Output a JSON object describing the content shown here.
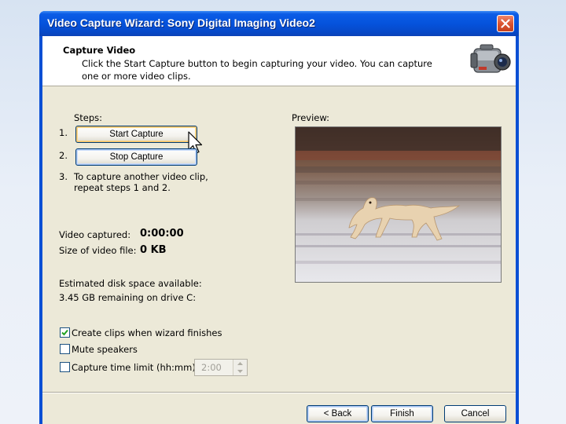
{
  "window": {
    "title": "Video Capture Wizard: Sony Digital Imaging Video2"
  },
  "header": {
    "title": "Capture Video",
    "description": "Click the Start Capture button to begin capturing your video. You can capture one or more video clips."
  },
  "steps": {
    "label": "Steps:",
    "step1_num": "1.",
    "start_capture_label": "Start Capture",
    "step2_num": "2.",
    "stop_capture_label": "Stop Capture",
    "step3_num": "3.",
    "step3_line1": "To capture another video clip,",
    "step3_line2": "repeat steps 1 and 2."
  },
  "preview": {
    "label": "Preview:"
  },
  "stats": {
    "video_captured_label": "Video captured:",
    "video_captured_value": "0:00:00",
    "file_size_label": "Size of video file:",
    "file_size_value": "0 KB",
    "disk_space_label": "Estimated disk space available:",
    "disk_space_value": "3.45 GB remaining on drive C:"
  },
  "options": {
    "create_clips": {
      "label": "Create clips when wizard finishes",
      "checked": true
    },
    "mute_speakers": {
      "label": "Mute speakers",
      "checked": false
    },
    "capture_time_limit": {
      "label": "Capture time limit (hh:mm):",
      "checked": false,
      "value": "2:00"
    }
  },
  "footer": {
    "back_label": "< Back",
    "finish_label": "Finish",
    "cancel_label": "Cancel"
  },
  "colors": {
    "titlebar": "#0553dc",
    "dialog_bg": "#ece9d8",
    "close_button": "#d9512d"
  },
  "icons": [
    "close-icon",
    "camcorder-icon",
    "mouse-cursor-icon",
    "checkmark-icon",
    "spinner-up-icon",
    "spinner-down-icon"
  ]
}
